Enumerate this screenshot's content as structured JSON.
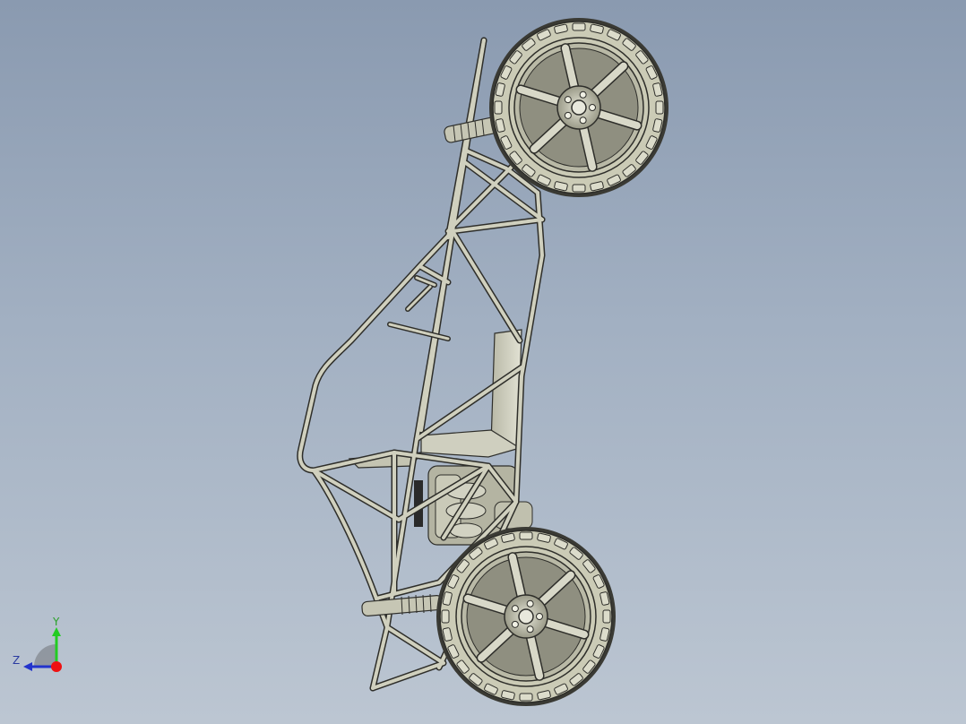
{
  "viewport": {
    "background_top": "#8a9ab0",
    "background_bottom": "#bcc6d2"
  },
  "model": {
    "subject": "buggy-chassis-assembly",
    "tube_color": "#c8c8b6",
    "tube_edge_color": "#2e2e2a",
    "tire_color": "#cbcbb6",
    "seat_color": "#d6d6c6"
  },
  "triad": {
    "y_label": "Y",
    "z_label": "Z",
    "y_color": "#22cc22",
    "z_color": "#2233cc",
    "x_origin_color": "#ee1111"
  }
}
